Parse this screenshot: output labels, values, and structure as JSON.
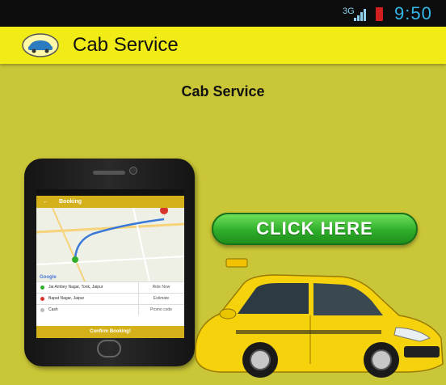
{
  "status_bar": {
    "network": "3G",
    "time": "9:50"
  },
  "app_bar": {
    "title": "Cab Service",
    "logo_icon": "taxi-logo-icon"
  },
  "content": {
    "title": "Cab Service",
    "click_button": "CLICK HERE"
  },
  "phone_screen": {
    "bar_title": "Booking",
    "google": "Google",
    "pickup": "Jai Ambey Nagar, Tonk, Jaipur",
    "drop": "Bapat Nagar, Jaipur",
    "payment": "Cash",
    "side_pickup": "Ride Now",
    "side_drop": "Estimate",
    "side_payment": "Promo code",
    "confirm": "Confirm Booking!"
  },
  "colors": {
    "background": "#c9c637",
    "app_bar": "#f2ec16",
    "button_green": "#2fae2a",
    "status_time": "#35b8e8"
  }
}
